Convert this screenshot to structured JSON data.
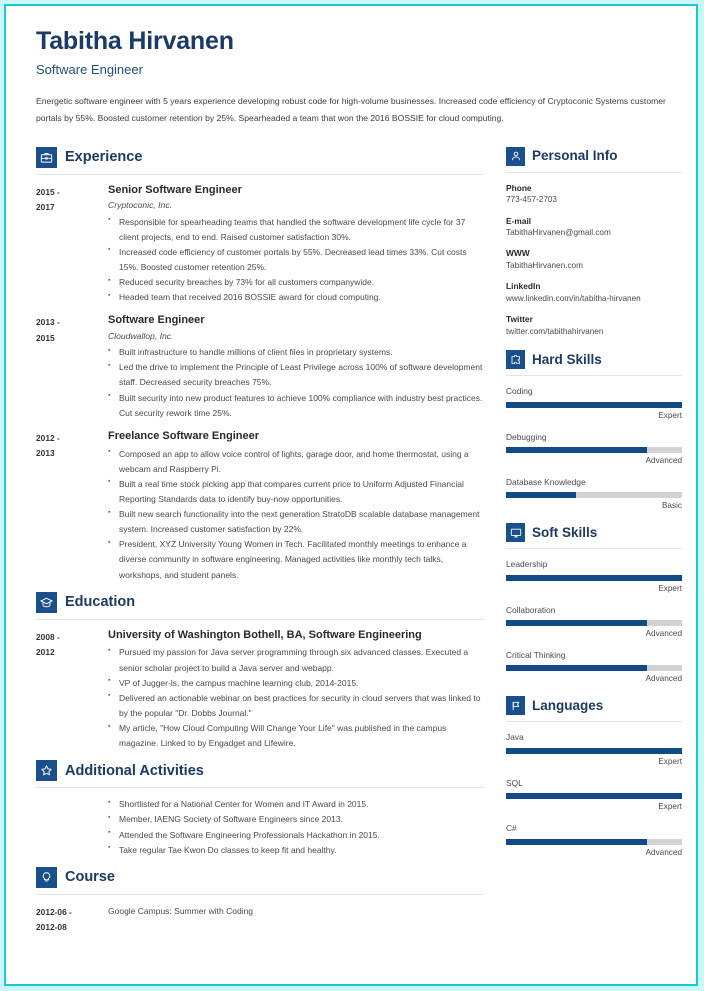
{
  "theme": {
    "accent": "#19508c",
    "heading": "#1b3a64",
    "frame": "#18c8d6",
    "frame_bg": "#ccf7f7",
    "bar_fill": "#124a87",
    "bar_track": "#d2d2d2"
  },
  "header": {
    "name": "Tabitha Hirvanen",
    "job_title": "Software Engineer",
    "summary": "Energetic software engineer with 5 years experience developing robust code for high-volume businesses. Increased code efficiency of Cryptoconic Systems customer portals by 55%. Boosted customer retention by 25%. Spearheaded a team that won the 2016 BOSSIE for cloud computing."
  },
  "main": {
    "experience": {
      "icon": "briefcase-icon",
      "title": "Experience",
      "entries": [
        {
          "dates": "2015 - 2017",
          "date_line1": "2015 -",
          "date_line2": "2017",
          "title": "Senior Software Engineer",
          "company": "Cryptoconic, Inc.",
          "bullets": [
            "Responsible for spearheading teams that handled the software development life cycle for 37 client projects, end to end. Raised customer satisfaction 30%.",
            "Increased code efficiency of customer portals by 55%. Decreased lead times 33%. Cut costs 15%. Boosted customer retention 25%.",
            "Reduced security breaches by 73% for all customers companywide.",
            "Headed team that received 2016 BOSSIE award for cloud computing."
          ]
        },
        {
          "dates": "2013 - 2015",
          "date_line1": "2013 -",
          "date_line2": "2015",
          "title": "Software Engineer",
          "company": "Cloudwallop, Inc.",
          "bullets": [
            "Built infrastructure to handle millions of client files in proprietary systems.",
            "Led the drive to implement the Principle of Least Privilege across 100% of software development staff. Decreased security breaches 75%.",
            "Built security into new product features to achieve 100% compliance with industry best practices. Cut security rework time 25%."
          ]
        },
        {
          "dates": "2012 - 2013",
          "date_line1": "2012 -",
          "date_line2": "2013",
          "title": "Freelance Software Engineer",
          "company": "",
          "bullets": [
            "Composed an app to allow voice control of lights, garage door, and home thermostat, using a webcam and Raspberry Pi.",
            "Built a real time stock picking app that compares current price to Uniform Adjusted Financial Reporting Standards data to identify buy-now opportunities.",
            "Built new search functionality into the next generation StratoDB scalable database management system. Increased customer satisfaction by 22%.",
            "President, XYZ University Young Women in Tech. Facilitated monthly meetings to enhance a diverse community in software engineering. Managed activities like monthly tech talks, workshops, and student panels."
          ]
        }
      ]
    },
    "education": {
      "icon": "graduation-cap-icon",
      "title": "Education",
      "entries": [
        {
          "dates": "2008 - 2012",
          "date_line1": "2008 -",
          "date_line2": "2012",
          "title": "University of Washington Bothell, BA, Software Engineering",
          "company": "",
          "bullets": [
            "Pursued my passion for Java server programming through six advanced classes. Executed a senior scholar project to build a Java server and webapp.",
            "VP of Jugger-ls, the campus machine learning club, 2014-2015.",
            "Delivered an actionable webinar on best practices for security in cloud servers that was linked to by the popular \"Dr. Dobbs Journal.\"",
            "My article, \"How Cloud Computing Will Change Your Life\" was published in the campus magazine. Linked to by Engadget and Lifewire."
          ]
        }
      ]
    },
    "additional_activities": {
      "icon": "star-icon",
      "title": "Additional Activities",
      "bullets": [
        "Shortlisted for a National Center for Women and IT Award in 2015.",
        "Member, IAENG Society of Software Engineers since 2013.",
        "Attended the Software Engineering Professionals Hackathon in 2015.",
        "Take regular Tae Kwon Do classes to keep fit and healthy."
      ]
    },
    "course": {
      "icon": "lightbulb-icon",
      "title": "Course",
      "entries": [
        {
          "dates": "2012-06 - 2012-08",
          "date_line1": "2012-06 -",
          "date_line2": "2012-08",
          "text": "Google Campus: Summer with Coding"
        }
      ]
    }
  },
  "sidebar": {
    "personal_info": {
      "icon": "person-icon",
      "title": "Personal Info",
      "items": [
        {
          "label": "Phone",
          "value": "773-457-2703"
        },
        {
          "label": "E-mail",
          "value": "TabithaHirvanen@gmail.com"
        },
        {
          "label": "WWW",
          "value": "TabithaHirvanen.com"
        },
        {
          "label": "LinkedIn",
          "value": "www.linkedin.com/in/tabitha-hirvanen"
        },
        {
          "label": "Twitter",
          "value": "twitter.com/tabithahirvanen"
        }
      ]
    },
    "hard_skills": {
      "icon": "puzzle-icon",
      "title": "Hard Skills",
      "items": [
        {
          "name": "Coding",
          "level": "Expert",
          "percent": 100
        },
        {
          "name": "Debugging",
          "level": "Advanced",
          "percent": 80
        },
        {
          "name": "Database Knowledge",
          "level": "Basic",
          "percent": 40
        }
      ]
    },
    "soft_skills": {
      "icon": "monitor-icon",
      "title": "Soft Skills",
      "items": [
        {
          "name": "Leadership",
          "level": "Expert",
          "percent": 100
        },
        {
          "name": "Collaboration",
          "level": "Advanced",
          "percent": 80
        },
        {
          "name": "Critical Thinking",
          "level": "Advanced",
          "percent": 80
        }
      ]
    },
    "languages": {
      "icon": "flag-icon",
      "title": "Languages",
      "items": [
        {
          "name": "Java",
          "level": "Expert",
          "percent": 100
        },
        {
          "name": "SQL",
          "level": "Expert",
          "percent": 100
        },
        {
          "name": "C#",
          "level": "Advanced",
          "percent": 80
        }
      ]
    }
  }
}
